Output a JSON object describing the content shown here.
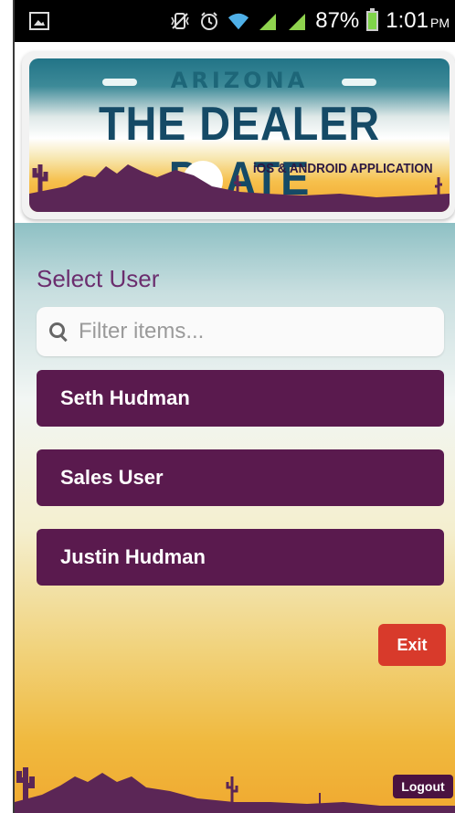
{
  "status_bar": {
    "battery": "87%",
    "time": "1:01",
    "ampm": "PM",
    "icons": [
      "gallery-icon",
      "vibrate-icon",
      "alarm-icon",
      "wifi-icon",
      "signal-icon",
      "signal-icon",
      "battery-charging-icon"
    ]
  },
  "header": {
    "state": "ARIZONA",
    "title": "THE DEALER PLATE",
    "subtitle": "iOS & ANDROID APPLICATION"
  },
  "main": {
    "heading": "Select User",
    "filter": {
      "placeholder": "Filter items...",
      "value": ""
    },
    "users": [
      {
        "label": "Seth Hudman"
      },
      {
        "label": "Sales User"
      },
      {
        "label": "Justin Hudman"
      }
    ],
    "exit_label": "Exit",
    "logout_label": "Logout"
  },
  "colors": {
    "accent": "#5a1a4e",
    "exit": "#d83a2b",
    "heading": "#6b2d6e",
    "plate_text": "#154a66"
  }
}
